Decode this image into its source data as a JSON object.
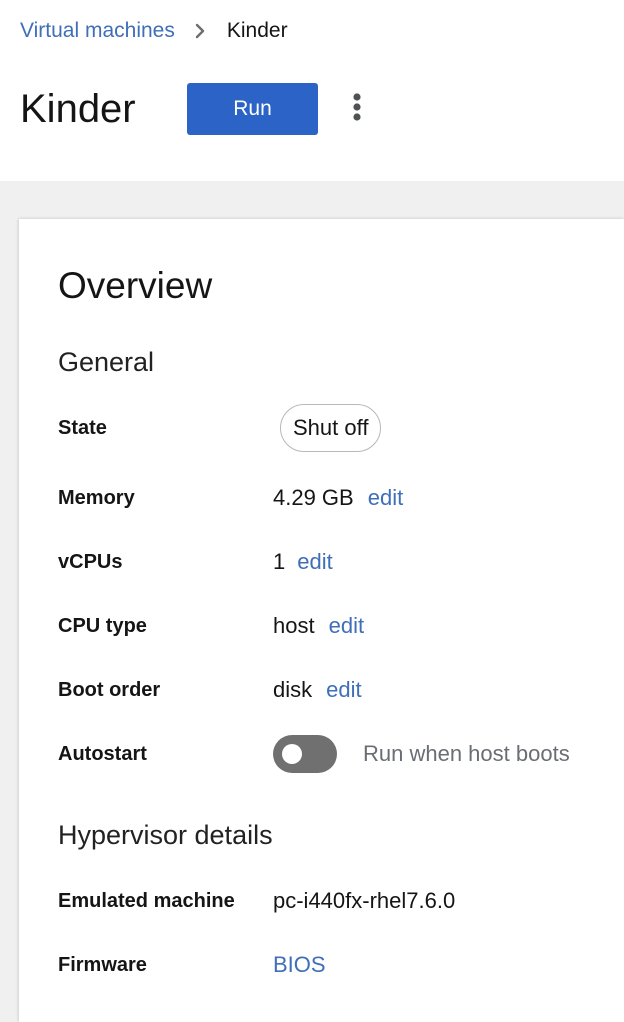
{
  "breadcrumb": {
    "parent": "Virtual machines",
    "current": "Kinder"
  },
  "header": {
    "title": "Kinder",
    "run_label": "Run"
  },
  "overview": {
    "title": "Overview",
    "general": {
      "title": "General",
      "state": {
        "label": "State",
        "value": "Shut off"
      },
      "memory": {
        "label": "Memory",
        "value": "4.29 GB",
        "action": "edit"
      },
      "vcpus": {
        "label": "vCPUs",
        "value": "1",
        "action": "edit"
      },
      "cpu_type": {
        "label": "CPU type",
        "value": "host",
        "action": "edit"
      },
      "boot_order": {
        "label": "Boot order",
        "value": "disk",
        "action": "edit"
      },
      "autostart": {
        "label": "Autostart",
        "toggle_label": "Run when host boots",
        "enabled": false
      }
    },
    "hypervisor": {
      "title": "Hypervisor details",
      "emulated_machine": {
        "label": "Emulated machine",
        "value": "pc-i440fx-rhel7.6.0"
      },
      "firmware": {
        "label": "Firmware",
        "value": "BIOS"
      }
    }
  },
  "colors": {
    "primary": "#2b63c6",
    "link": "#3f6fb8",
    "toggle_off": "#707070",
    "background": "#f0f0f0"
  },
  "icons": {
    "breadcrumb_separator": "chevron-right-icon",
    "kebab": "kebab-menu-icon"
  }
}
